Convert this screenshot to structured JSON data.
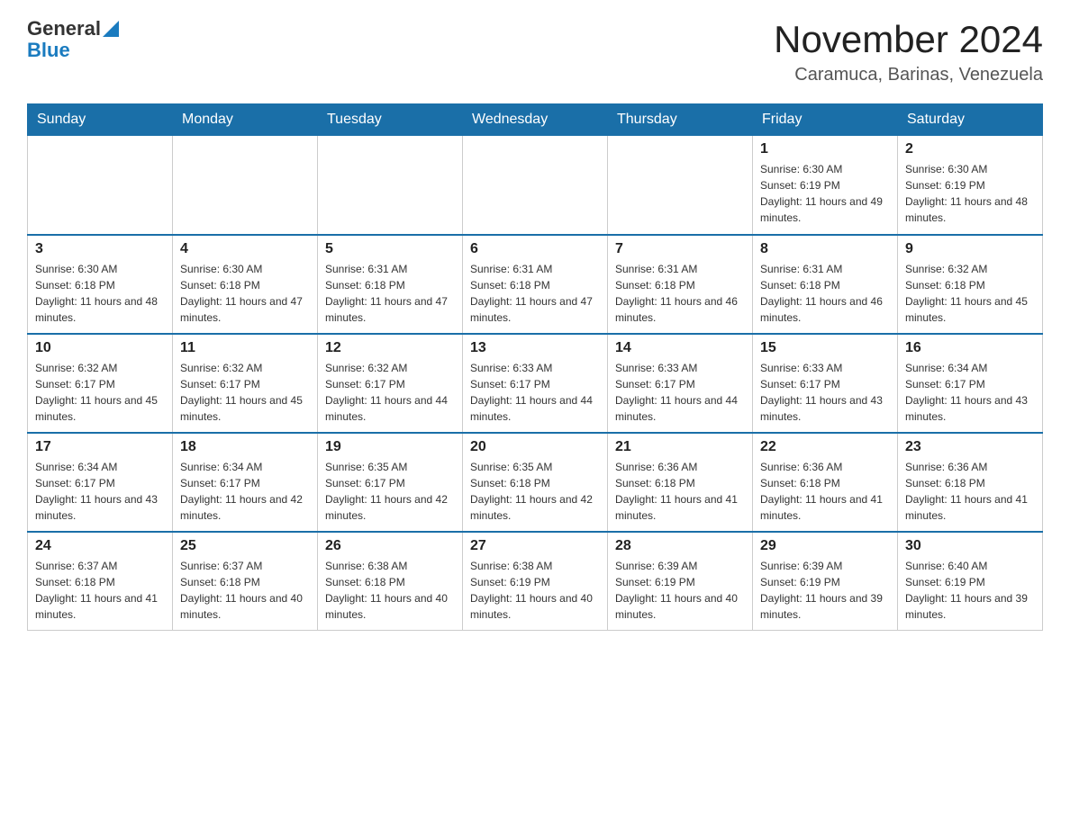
{
  "header": {
    "logo_general": "General",
    "logo_blue": "Blue",
    "title": "November 2024",
    "location": "Caramuca, Barinas, Venezuela"
  },
  "days_of_week": [
    "Sunday",
    "Monday",
    "Tuesday",
    "Wednesday",
    "Thursday",
    "Friday",
    "Saturday"
  ],
  "weeks": [
    [
      {
        "day": "",
        "info": ""
      },
      {
        "day": "",
        "info": ""
      },
      {
        "day": "",
        "info": ""
      },
      {
        "day": "",
        "info": ""
      },
      {
        "day": "",
        "info": ""
      },
      {
        "day": "1",
        "info": "Sunrise: 6:30 AM\nSunset: 6:19 PM\nDaylight: 11 hours and 49 minutes."
      },
      {
        "day": "2",
        "info": "Sunrise: 6:30 AM\nSunset: 6:19 PM\nDaylight: 11 hours and 48 minutes."
      }
    ],
    [
      {
        "day": "3",
        "info": "Sunrise: 6:30 AM\nSunset: 6:18 PM\nDaylight: 11 hours and 48 minutes."
      },
      {
        "day": "4",
        "info": "Sunrise: 6:30 AM\nSunset: 6:18 PM\nDaylight: 11 hours and 47 minutes."
      },
      {
        "day": "5",
        "info": "Sunrise: 6:31 AM\nSunset: 6:18 PM\nDaylight: 11 hours and 47 minutes."
      },
      {
        "day": "6",
        "info": "Sunrise: 6:31 AM\nSunset: 6:18 PM\nDaylight: 11 hours and 47 minutes."
      },
      {
        "day": "7",
        "info": "Sunrise: 6:31 AM\nSunset: 6:18 PM\nDaylight: 11 hours and 46 minutes."
      },
      {
        "day": "8",
        "info": "Sunrise: 6:31 AM\nSunset: 6:18 PM\nDaylight: 11 hours and 46 minutes."
      },
      {
        "day": "9",
        "info": "Sunrise: 6:32 AM\nSunset: 6:18 PM\nDaylight: 11 hours and 45 minutes."
      }
    ],
    [
      {
        "day": "10",
        "info": "Sunrise: 6:32 AM\nSunset: 6:17 PM\nDaylight: 11 hours and 45 minutes."
      },
      {
        "day": "11",
        "info": "Sunrise: 6:32 AM\nSunset: 6:17 PM\nDaylight: 11 hours and 45 minutes."
      },
      {
        "day": "12",
        "info": "Sunrise: 6:32 AM\nSunset: 6:17 PM\nDaylight: 11 hours and 44 minutes."
      },
      {
        "day": "13",
        "info": "Sunrise: 6:33 AM\nSunset: 6:17 PM\nDaylight: 11 hours and 44 minutes."
      },
      {
        "day": "14",
        "info": "Sunrise: 6:33 AM\nSunset: 6:17 PM\nDaylight: 11 hours and 44 minutes."
      },
      {
        "day": "15",
        "info": "Sunrise: 6:33 AM\nSunset: 6:17 PM\nDaylight: 11 hours and 43 minutes."
      },
      {
        "day": "16",
        "info": "Sunrise: 6:34 AM\nSunset: 6:17 PM\nDaylight: 11 hours and 43 minutes."
      }
    ],
    [
      {
        "day": "17",
        "info": "Sunrise: 6:34 AM\nSunset: 6:17 PM\nDaylight: 11 hours and 43 minutes."
      },
      {
        "day": "18",
        "info": "Sunrise: 6:34 AM\nSunset: 6:17 PM\nDaylight: 11 hours and 42 minutes."
      },
      {
        "day": "19",
        "info": "Sunrise: 6:35 AM\nSunset: 6:17 PM\nDaylight: 11 hours and 42 minutes."
      },
      {
        "day": "20",
        "info": "Sunrise: 6:35 AM\nSunset: 6:18 PM\nDaylight: 11 hours and 42 minutes."
      },
      {
        "day": "21",
        "info": "Sunrise: 6:36 AM\nSunset: 6:18 PM\nDaylight: 11 hours and 41 minutes."
      },
      {
        "day": "22",
        "info": "Sunrise: 6:36 AM\nSunset: 6:18 PM\nDaylight: 11 hours and 41 minutes."
      },
      {
        "day": "23",
        "info": "Sunrise: 6:36 AM\nSunset: 6:18 PM\nDaylight: 11 hours and 41 minutes."
      }
    ],
    [
      {
        "day": "24",
        "info": "Sunrise: 6:37 AM\nSunset: 6:18 PM\nDaylight: 11 hours and 41 minutes."
      },
      {
        "day": "25",
        "info": "Sunrise: 6:37 AM\nSunset: 6:18 PM\nDaylight: 11 hours and 40 minutes."
      },
      {
        "day": "26",
        "info": "Sunrise: 6:38 AM\nSunset: 6:18 PM\nDaylight: 11 hours and 40 minutes."
      },
      {
        "day": "27",
        "info": "Sunrise: 6:38 AM\nSunset: 6:19 PM\nDaylight: 11 hours and 40 minutes."
      },
      {
        "day": "28",
        "info": "Sunrise: 6:39 AM\nSunset: 6:19 PM\nDaylight: 11 hours and 40 minutes."
      },
      {
        "day": "29",
        "info": "Sunrise: 6:39 AM\nSunset: 6:19 PM\nDaylight: 11 hours and 39 minutes."
      },
      {
        "day": "30",
        "info": "Sunrise: 6:40 AM\nSunset: 6:19 PM\nDaylight: 11 hours and 39 minutes."
      }
    ]
  ]
}
